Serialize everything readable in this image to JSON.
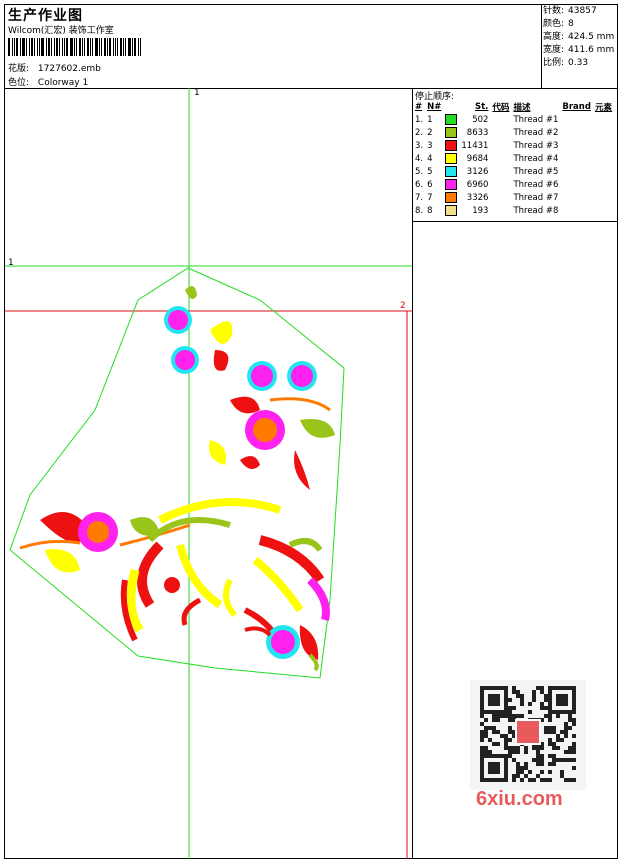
{
  "header": {
    "title": "生产作业图",
    "subtitle": "Wilcom(汇宏) 装饰工作室",
    "design_label": "花版:",
    "design_file": "1727602.emb",
    "colorway_label": "色位:",
    "colorway": "Colorway 1"
  },
  "stats": {
    "stitches_label": "针数:",
    "stitches": "43857",
    "colors_label": "颜色:",
    "colors": "8",
    "height_label": "高度:",
    "height": "424.5 mm",
    "width_label": "宽度:",
    "width": "411.6 mm",
    "scale_label": "比例:",
    "scale": "0.33"
  },
  "legend": {
    "title": "停止顺序:",
    "columns": [
      "#",
      "N#",
      "St.",
      "代码",
      "描述",
      "Brand",
      "元素"
    ],
    "rows": [
      {
        "idx": "1.",
        "n": "1",
        "color": "#22dd22",
        "stitches": "502",
        "desc": "Thread #1"
      },
      {
        "idx": "2.",
        "n": "2",
        "color": "#99c41a",
        "stitches": "8633",
        "desc": "Thread #2"
      },
      {
        "idx": "3.",
        "n": "3",
        "color": "#ee1111",
        "stitches": "11431",
        "desc": "Thread #3"
      },
      {
        "idx": "4.",
        "n": "4",
        "color": "#ffff00",
        "stitches": "9684",
        "desc": "Thread #4"
      },
      {
        "idx": "5.",
        "n": "5",
        "color": "#22e5f0",
        "stitches": "3126",
        "desc": "Thread #5"
      },
      {
        "idx": "6.",
        "n": "6",
        "color": "#ff22ee",
        "stitches": "6960",
        "desc": "Thread #6"
      },
      {
        "idx": "7.",
        "n": "7",
        "color": "#ff7a00",
        "stitches": "3326",
        "desc": "Thread #7"
      },
      {
        "idx": "8.",
        "n": "8",
        "color": "#f5e08a",
        "stitches": "193",
        "desc": "Thread #8"
      }
    ]
  },
  "guides": {
    "v1": "1",
    "h1": "1",
    "h2": "2"
  },
  "watermark": "6xiu.com"
}
